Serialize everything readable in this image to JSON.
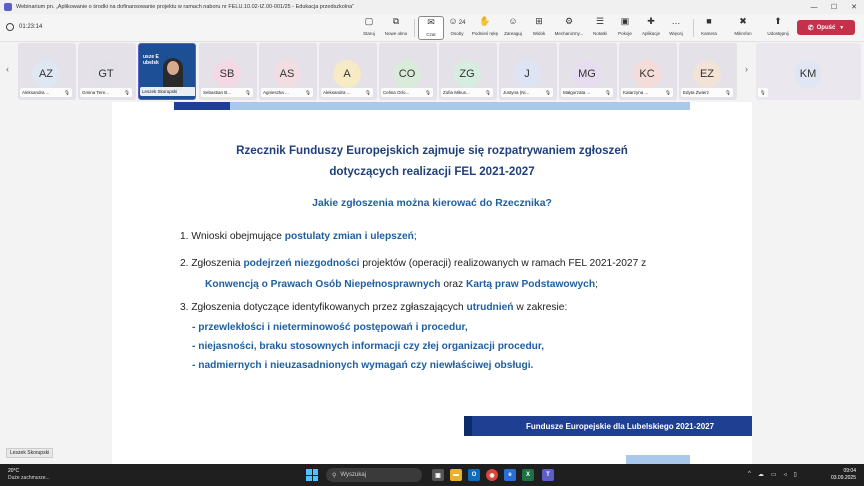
{
  "window": {
    "title": "Webinarium pn. „Aplikowanie o środki na dofinansowanie projektu w ramach naboru nr FELU.10.02-IZ.00-001/25 - Edukacja przedszkolna”",
    "controls": [
      "—",
      "☐",
      "✕"
    ]
  },
  "toolbar": {
    "timer": "01:23:14",
    "buttons": [
      {
        "label": "Staruj",
        "icon": "▢"
      },
      {
        "label": "Nowe okno",
        "icon": "⧉"
      },
      {
        "label": "Czat",
        "icon": "✉"
      },
      {
        "label": "Osoby",
        "icon": "☺",
        "count": "24"
      },
      {
        "label": "Podnieś rękę",
        "icon": "✋"
      },
      {
        "label": "Zareaguj",
        "icon": "☺"
      },
      {
        "label": "Widok",
        "icon": "⊞"
      },
      {
        "label": "Mechanizmy...",
        "icon": "⚙"
      },
      {
        "label": "Notatki",
        "icon": "☰"
      },
      {
        "label": "Pokoje",
        "icon": "▣"
      },
      {
        "label": "Aplikacje",
        "icon": "✚"
      },
      {
        "label": "Więcej",
        "icon": "…"
      },
      {
        "label": "Kamera",
        "icon": "■"
      },
      {
        "label": "Mikrofon",
        "icon": "✖"
      },
      {
        "label": "Udostępnij",
        "icon": "⬆"
      }
    ],
    "leave_label": "Opuść"
  },
  "participants": [
    {
      "initials": "AZ",
      "name": "Aleksandra ...",
      "color": "#dfe7f2"
    },
    {
      "initials": "GT",
      "name": "Gmina Tere...",
      "color": "#e3e1e8"
    },
    {
      "initials": "",
      "name": "Leszek Skorupski",
      "video": true,
      "banner": "usze Europ\nubelskie"
    },
    {
      "initials": "SB",
      "name": "Sebastian B...",
      "color": "#f4d9e4"
    },
    {
      "initials": "AS",
      "name": "Agnieszka ...",
      "color": "#f2dde2"
    },
    {
      "initials": "A",
      "name": "Aleksandra ...",
      "color": "#f6ebc5"
    },
    {
      "initials": "CO",
      "name": "Celina Orlo...",
      "color": "#d9ecd9"
    },
    {
      "initials": "ZG",
      "name": "Zofia Mikus...",
      "color": "#d7ede0"
    },
    {
      "initials": "J",
      "name": "Justyna (Ni...",
      "color": "#dfe4f4"
    },
    {
      "initials": "MG",
      "name": "Małgorzata ...",
      "color": "#e6def0"
    },
    {
      "initials": "KC",
      "name": "Katarzyna ...",
      "color": "#f4dcd8"
    },
    {
      "initials": "EZ",
      "name": "Edyta Żwierz",
      "color": "#f2e3d6"
    },
    {
      "initials": "KM",
      "name": "",
      "color": "#e0e6f2"
    }
  ],
  "slide": {
    "title_line1": "Rzecznik Funduszy Europejskich zajmuje się rozpatrywaniem zgłoszeń",
    "title_line2": "dotyczących realizacji FEL 2021-2027",
    "subtitle": "Jakie zgłoszenia można kierować do Rzecznika?",
    "item1": {
      "prefix": "1. Wnioski obejmujące ",
      "highlight": "postulaty zmian i ulepszeń",
      "suffix": ";"
    },
    "item2": {
      "prefix": "2. Zgłoszenia ",
      "highlight1": "podejrzeń niezgodności",
      "middle": " projektów (operacji) realizowanych w ramach FEL 2021-2027 z",
      "highlight2": "Konwencją o Prawach Osób Niepełnosprawnych",
      "middle2": " oraz ",
      "highlight3": "Kartą praw Podstawowych",
      "suffix": ";"
    },
    "item3": {
      "prefix": "3. Zgłoszenia dotyczące identyfikowanych przez zgłaszających ",
      "highlight": "utrudnień",
      "suffix": " w zakresie:",
      "subitems": [
        "- przewlekłości i nieterminowość postępowań i procedur,",
        "- niejasności, braku stosownych informacji czy złej organizacji procedur,",
        "- nadmiernych i nieuzasadnionych wymagań czy niewłaściwej obsługi."
      ]
    },
    "footer": "Fundusze Europejskie dla Lubelskiego 2021-2027"
  },
  "presenter_label": "Leszek Skorupski",
  "taskbar": {
    "weather_temp": "20°C",
    "weather_desc": "Duże zachmurze...",
    "search_placeholder": "Wyszukaj",
    "time": "09:04",
    "date": "03.09.2025"
  }
}
